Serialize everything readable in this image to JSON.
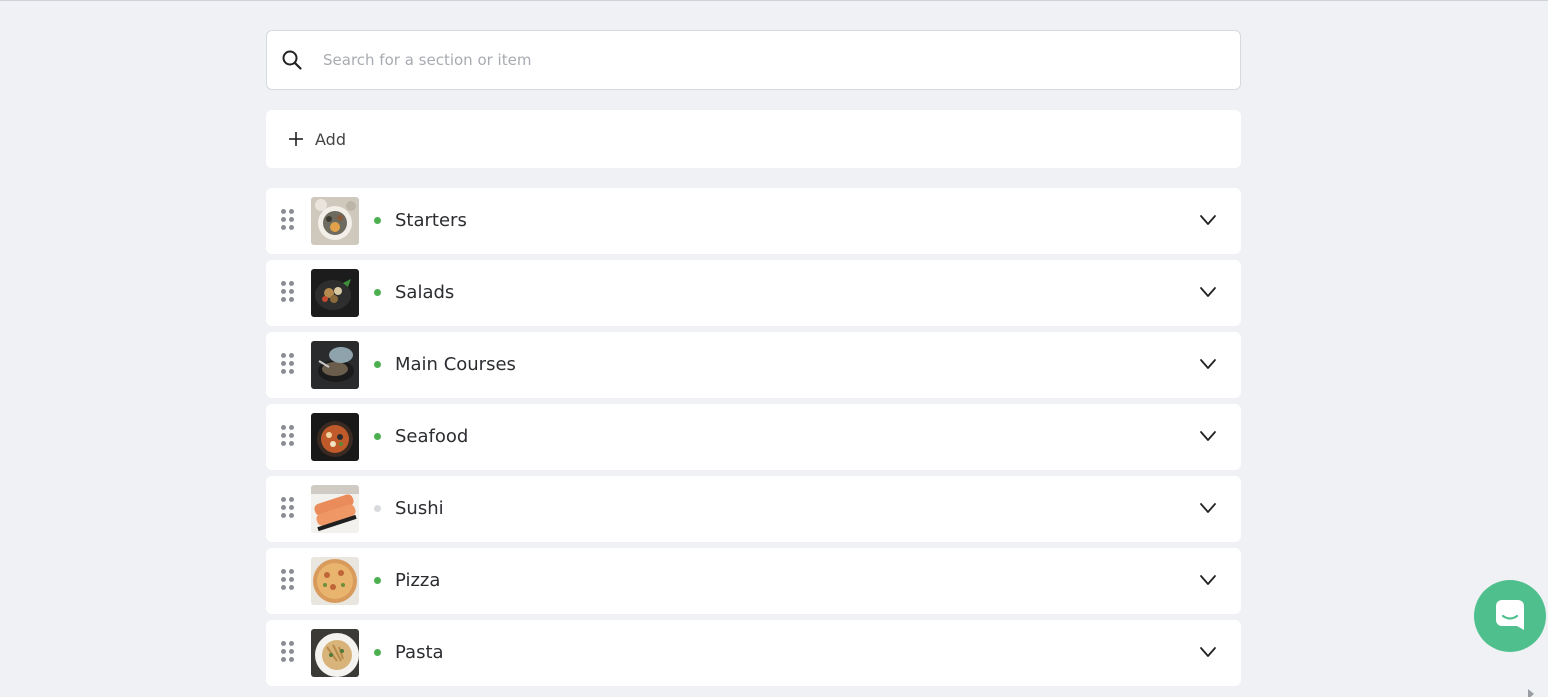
{
  "search": {
    "placeholder": "Search for a section or item",
    "value": "",
    "icon": "search-icon"
  },
  "add_bar": {
    "icon": "plus-icon",
    "label": "Add"
  },
  "colors": {
    "active_status": "#4caf50",
    "inactive_status": "#d8dadd",
    "chat_button": "#4fc08d",
    "background": "#f0f1f4"
  },
  "sections": [
    {
      "name": "Starters",
      "status": "active",
      "thumb": "starters"
    },
    {
      "name": "Salads",
      "status": "active",
      "thumb": "salads"
    },
    {
      "name": "Main Courses",
      "status": "active",
      "thumb": "main"
    },
    {
      "name": "Seafood",
      "status": "active",
      "thumb": "seafood"
    },
    {
      "name": "Sushi",
      "status": "inactive",
      "thumb": "sushi"
    },
    {
      "name": "Pizza",
      "status": "active",
      "thumb": "pizza"
    },
    {
      "name": "Pasta",
      "status": "active",
      "thumb": "pasta"
    }
  ],
  "chat_widget": {
    "icon": "chat-icon"
  }
}
